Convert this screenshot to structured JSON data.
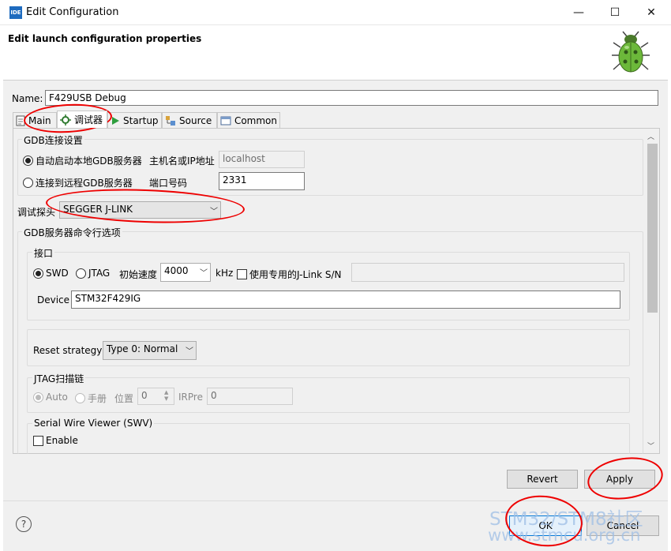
{
  "window": {
    "title": "Edit Configuration",
    "app_icon_text": "IDE",
    "minimize": "—",
    "maximize": "☐",
    "close": "✕"
  },
  "banner": {
    "title": "Edit launch configuration properties"
  },
  "name": {
    "label": "Name:",
    "value": "F429USB Debug"
  },
  "tabs": [
    {
      "label": "Main"
    },
    {
      "label": "调试器"
    },
    {
      "label": "Startup"
    },
    {
      "label": "Source"
    },
    {
      "label": "Common"
    }
  ],
  "gdb_connection": {
    "group_label": "GDB连接设置",
    "local_option": "自动启动本地GDB服务器",
    "host_label": "主机名或IP地址",
    "host_value": "localhost",
    "remote_option": "连接到远程GDB服务器",
    "port_label": "端口号码",
    "port_value": "2331"
  },
  "probe": {
    "label": "调试探头",
    "value": "SEGGER J-LINK"
  },
  "gdb_server_options": {
    "group_label": "GDB服务器命令行选项",
    "interface": {
      "group_label": "接口",
      "swd": "SWD",
      "jtag": "JTAG",
      "speed_label": "初始速度",
      "speed_value": "4000",
      "speed_unit": "kHz",
      "sn_checkbox": "使用专用的J-Link S/N",
      "sn_value": ""
    },
    "device_label": "Device",
    "device_value": "STM32F429IG",
    "reset_label": "Reset strategy",
    "reset_value": "Type 0: Normal",
    "jtag_chain": {
      "group_label": "JTAG扫描链",
      "auto": "Auto",
      "manual": "手册",
      "position_label": "位置",
      "position_value": "0",
      "irpre_label": "IRPre",
      "irpre_value": "0"
    },
    "swv": {
      "group_label": "Serial Wire Viewer (SWV)",
      "enable_label": "Enable"
    }
  },
  "buttons": {
    "revert": "Revert",
    "apply": "Apply",
    "ok": "OK",
    "cancel": "Cancel",
    "help": "?"
  },
  "watermark": {
    "line1": "STM32/STM8社区",
    "line2": "www.stmcu.org.cn"
  },
  "colors": {
    "annotation": "#e00000",
    "accent": "#1e6bbf",
    "watermark": "#9fbfe6"
  }
}
